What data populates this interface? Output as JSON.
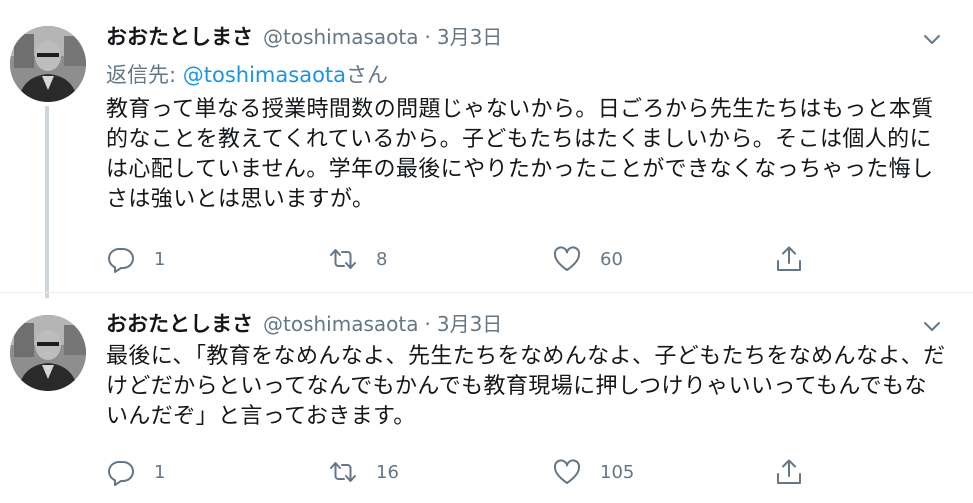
{
  "tweets": [
    {
      "display_name": "おおたとしまさ",
      "handle": "@toshimasaota",
      "separator": "·",
      "date": "3月3日",
      "reply_to": {
        "prefix": "返信先: ",
        "mention": "@toshimasaota",
        "suffix": "さん"
      },
      "text": "教育って単なる授業時間数の問題じゃないから。日ごろから先生たちはもっと本質的なことを教えてくれているから。子どもたちはたくましいから。そこは個人的には心配していません。学年の最後にやりたかったことができなくなっちゃった悔しさは強いとは思いますが。",
      "counts": {
        "replies": "1",
        "retweets": "8",
        "likes": "60"
      }
    },
    {
      "display_name": "おおたとしまさ",
      "handle": "@toshimasaota",
      "separator": "·",
      "date": "3月3日",
      "text": "最後に、「教育をなめんなよ、先生たちをなめんなよ、子どもたちをなめんなよ、だけどだからといってなんでもかんでも教育現場に押しつけりゃいいってもんでもないんだぞ」と言っておきます。",
      "counts": {
        "replies": "1",
        "retweets": "16",
        "likes": "105"
      }
    }
  ],
  "icons": {
    "reply": "speech-bubble-icon",
    "retweet": "retweet-arrows-icon",
    "like": "heart-outline-icon",
    "share": "share-upload-icon",
    "menu": "chevron-down-icon"
  },
  "colors": {
    "text": "#14171a",
    "secondary": "#657786",
    "link": "#1b95e0",
    "thread_line": "#ccd6dd"
  }
}
